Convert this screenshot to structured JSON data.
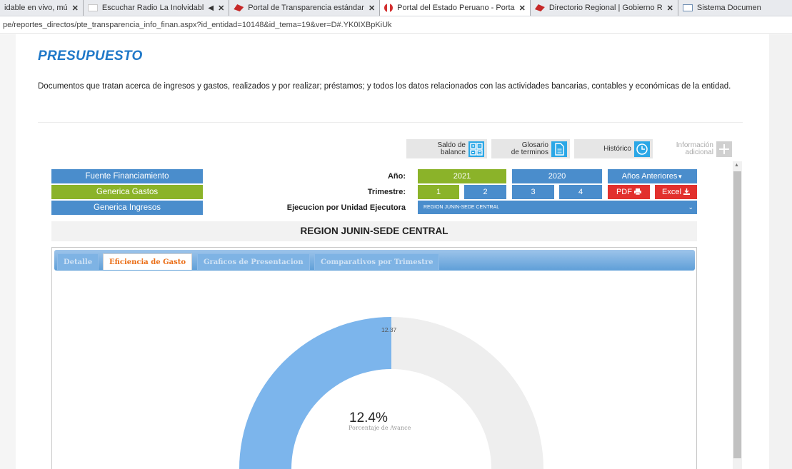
{
  "browser": {
    "tabs": [
      {
        "label": "idable en vivo, mú",
        "fav": "none",
        "speaker": false
      },
      {
        "label": "Escuchar Radio La Inolvidabl",
        "fav": "white",
        "speaker": true
      },
      {
        "label": "Portal de Transparencia estándar",
        "fav": "red",
        "speaker": false
      },
      {
        "label": "Portal del Estado Peruano - Porta",
        "fav": "flag",
        "speaker": false,
        "active": true
      },
      {
        "label": "Directorio Regional | Gobierno R",
        "fav": "red",
        "speaker": false
      },
      {
        "label": "Sistema Documen",
        "fav": "doc",
        "speaker": false
      }
    ],
    "close_glyph": "✕",
    "speaker_glyph": "◀",
    "url": "pe/reportes_directos/pte_transparencia_info_finan.aspx?id_entidad=10148&id_tema=19&ver=D#.YK0IXBpKiUk"
  },
  "page": {
    "title": "PRESUPUESTO",
    "description": "Documentos que tratan acerca de ingresos y gastos, realizados y por realizar; préstamos; y todos los datos relacionados con las actividades bancarias, contables y económicas de la entidad."
  },
  "top_buttons": {
    "saldo_l1": "Saldo de",
    "saldo_l2": "balance",
    "glosario_l1": "Glosario",
    "glosario_l2": "de terminos",
    "historico": "Histórico",
    "info_l1": "Información",
    "info_l2": "adicional"
  },
  "menu": {
    "fuente": "Fuente Financiamiento",
    "gastos": "Generica Gastos",
    "ingresos": "Generica Ingresos"
  },
  "filters": {
    "anio_label": "Año:",
    "anio_2021": "2021",
    "anio_2020": "2020",
    "anios_anteriores": "Años Anteriores",
    "trimestre_label": "Trimestre:",
    "t1": "1",
    "t2": "2",
    "t3": "3",
    "t4": "4",
    "pdf": "PDF",
    "excel": "Excel",
    "ejecucion_label": "Ejecucion por Unidad Ejecutora",
    "unidad_value": "REGION JUNIN-SEDE CENTRAL",
    "chevron": "⌄"
  },
  "region_title": "REGION JUNIN-SEDE CENTRAL",
  "panel_tabs": {
    "detalle": "Detalle",
    "eficiencia": "Eficiencia de Gasto",
    "graficos": "Graficos de Presentacion",
    "comparativos": "Comparativos por Trimestre"
  },
  "gauge": {
    "value": 12.37,
    "value_label": "12.37",
    "percent_label": "12.4%",
    "subtitle": "Porcentaje de Avance",
    "fill_color": "#7cb5ec",
    "track_color": "#eeeeee"
  },
  "colors": {
    "title": "#1f78c8",
    "green": "#8bb329",
    "blue": "#4a8dcc",
    "red": "#e2302d",
    "active_tab_text": "#ea6c14"
  }
}
